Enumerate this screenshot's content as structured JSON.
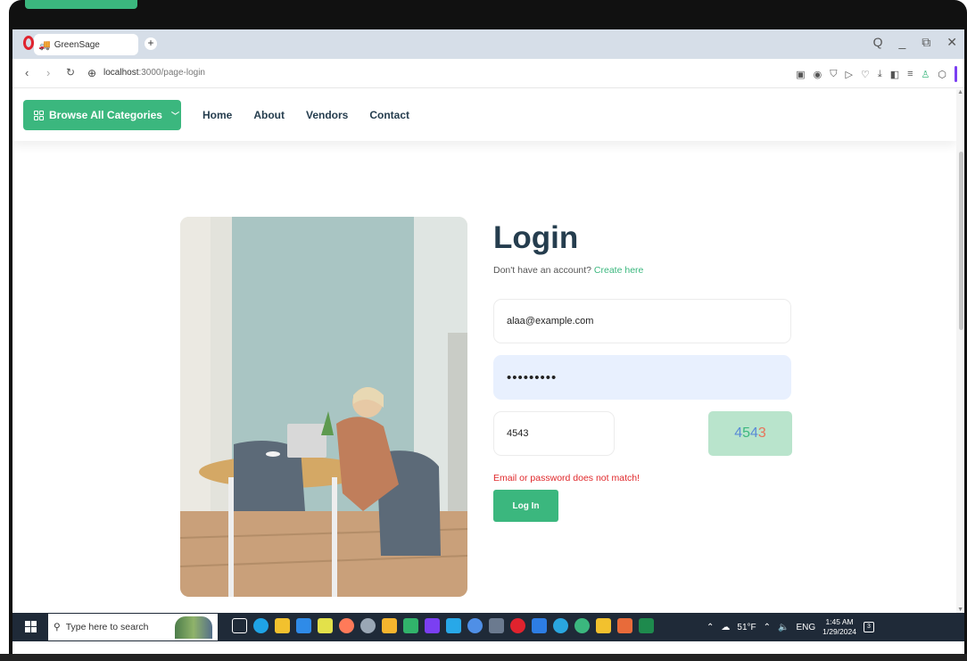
{
  "browser": {
    "tab_title": "GreenSage",
    "new_tab_symbol": "+",
    "url_host": "localhost",
    "url_path": ":3000/page-login",
    "window_controls": [
      "Q",
      "_",
      "⧉",
      "✕"
    ]
  },
  "header": {
    "browse_label": "Browse All Categories",
    "nav": [
      "Home",
      "About",
      "Vendors",
      "Contact"
    ]
  },
  "login": {
    "title": "Login",
    "signup_prompt": "Don't have an account?",
    "signup_link": "Create here",
    "email_value": "alaa@example.com",
    "password_value": "•••••••••",
    "captcha_input": "4543",
    "captcha_code": [
      "4",
      "5",
      "4",
      "3"
    ],
    "captcha_colors": [
      "#5a8bd6",
      "#3bb77e",
      "#5a8bd6",
      "#e8735a"
    ],
    "error_message": "Email or password does not match!",
    "submit_label": "Log In"
  },
  "taskbar": {
    "search_placeholder": "Type here to search",
    "weather": "51°F",
    "language": "ENG",
    "time": "1:45 AM",
    "date": "1/29/2024",
    "notification_count": "3"
  },
  "colors": {
    "brand_green": "#3bb77e",
    "heading": "#253d4e",
    "error": "#e0282b"
  }
}
